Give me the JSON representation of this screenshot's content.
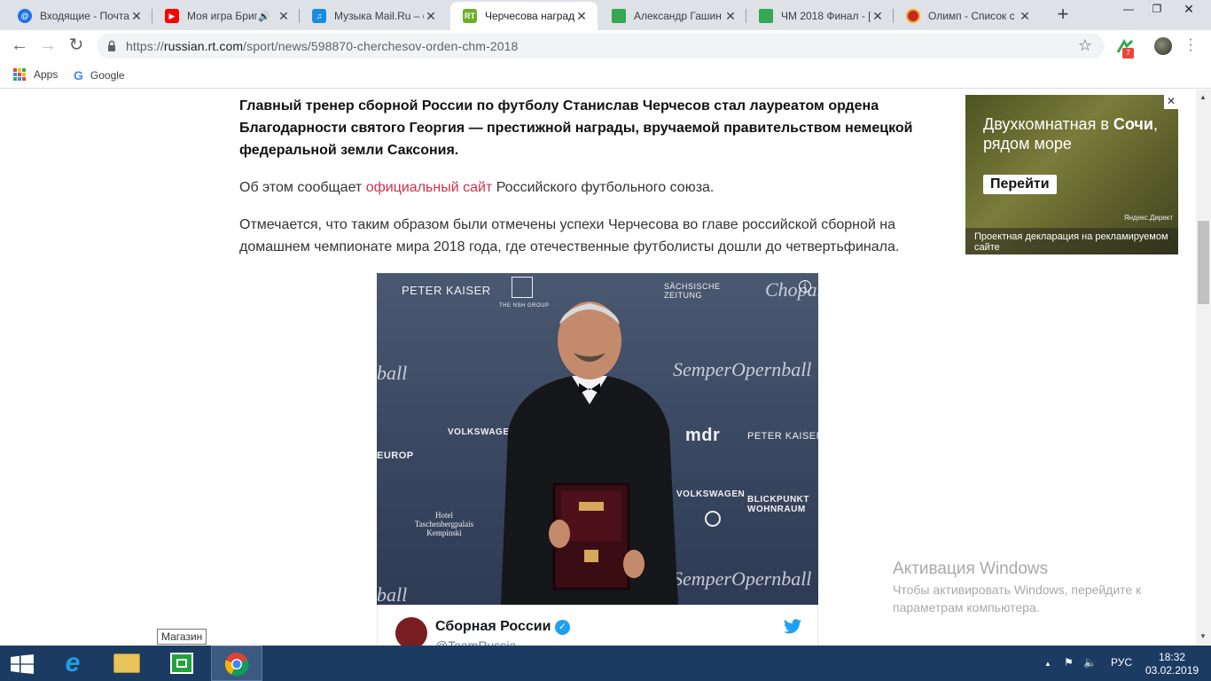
{
  "tabs": [
    {
      "title": "Входящие - Почта",
      "icon": "mail-icon",
      "color": "#1a73e8"
    },
    {
      "title": "Моя игра Брип",
      "icon": "youtube-icon",
      "color": "#ff0000"
    },
    {
      "title": "Музыка Mail.Ru – с",
      "icon": "music-icon",
      "color": "#168de2"
    },
    {
      "title": "Черчесова наград",
      "icon": "rt-icon",
      "color": "#6ab023"
    },
    {
      "title": "Александр Гашин",
      "icon": "sheet-icon",
      "color": "#34a853"
    },
    {
      "title": "ЧМ 2018 Финал - [",
      "icon": "sheet-icon",
      "color": "#34a853"
    },
    {
      "title": "Олимп - Список с",
      "icon": "olimp-icon",
      "color": "#c62828"
    }
  ],
  "address": {
    "host": "russian.rt.com",
    "path": "/sport/news/598870-cherchesov-orden-chm-2018",
    "scheme": "https://"
  },
  "bookmarks": {
    "apps": "Apps",
    "google": "Google"
  },
  "article": {
    "lead": "Главный тренер сборной России по футболу Станислав Черчесов стал лауреатом ордена Благодарности святого Георгия — престижной награды, вручаемой правительством немецкой федеральной земли Саксония.",
    "p1_before": "Об этом сообщает ",
    "p1_link": "официальный сайт",
    "p1_after": " Российского футбольного союза.",
    "p2": "Отмечается, что таким образом были отмечены успехи Черчесова во главе российской сборной на домашнем чемпионате мира 2018 года, где отечественные футболисты дошли до четвертьфинала."
  },
  "photo_wall": {
    "peter_kaiser": "PETER KAISER",
    "nsh": "THE NSH GROUP",
    "sz": "SÄCHSISCHE ZEITUNG",
    "chopard": "Chopard",
    "semper": "SemperOpernball",
    "volkswagen": "VOLKSWAGEN",
    "mdr": "mdr",
    "blickpunkt": "BLICKPUNKT WOHNRAUM",
    "hotel": "Hotel Taschenbergpalais Kempinski",
    "europ": "EUROP",
    "ball": "ball"
  },
  "tweet": {
    "name": "Сборная России",
    "handle": "@TeamRussia"
  },
  "ad": {
    "title_part1": "Двухкомнатная в ",
    "title_bold": "Сочи",
    "title_part2": ", рядом море",
    "button": "Перейти",
    "network": "Яндекс.Директ",
    "footer": "Проектная декларация на рекламируемом сайте"
  },
  "activation": {
    "title": "Активация Windows",
    "text": "Чтобы активировать Windows, перейдите к параметрам компьютера."
  },
  "tooltip": "Магазин",
  "taskbar": {
    "lang": "РУС",
    "time": "18:32",
    "date": "03.02.2019"
  }
}
